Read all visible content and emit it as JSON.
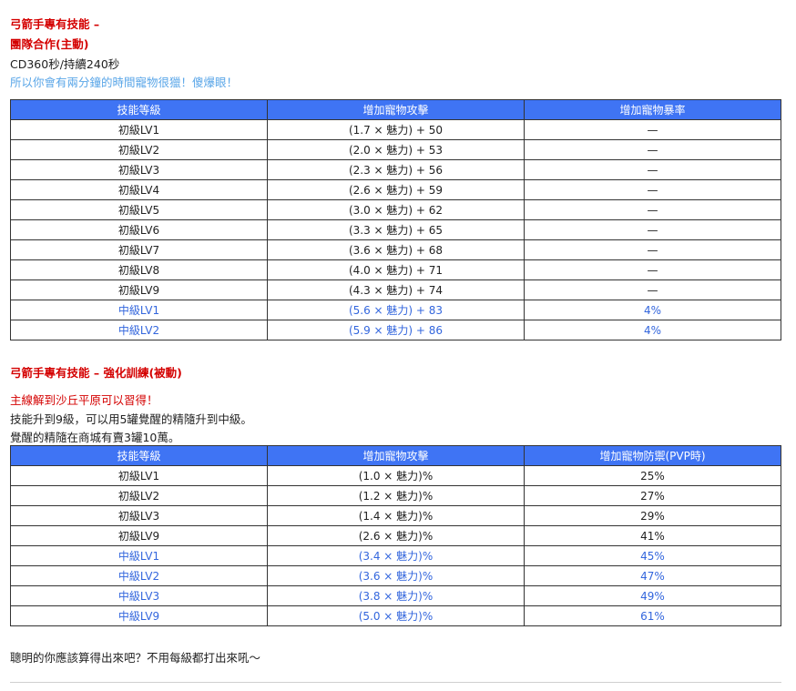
{
  "section1": {
    "heading": "弓箭手專有技能 –",
    "skill_name": "團隊合作(主動)",
    "cooldown": "CD360秒/持續240秒",
    "note": "所以你會有兩分鐘的時間寵物很獵！傻爆眼！",
    "table": {
      "headers": [
        "技能等級",
        "增加寵物攻擊",
        "增加寵物暴率"
      ],
      "rows": [
        {
          "level": "初級LV1",
          "attack": "(1.7 × 魅力) + 50",
          "extra": "—"
        },
        {
          "level": "初級LV2",
          "attack": "(2.0 × 魅力) + 53",
          "extra": "—"
        },
        {
          "level": "初級LV3",
          "attack": "(2.3 × 魅力) + 56",
          "extra": "—"
        },
        {
          "level": "初級LV4",
          "attack": "(2.6 × 魅力) + 59",
          "extra": "—"
        },
        {
          "level": "初級LV5",
          "attack": "(3.0 × 魅力) + 62",
          "extra": "—"
        },
        {
          "level": "初級LV6",
          "attack": "(3.3 × 魅力) + 65",
          "extra": "—"
        },
        {
          "level": "初級LV7",
          "attack": "(3.6 × 魅力) + 68",
          "extra": "—"
        },
        {
          "level": "初級LV8",
          "attack": "(4.0 × 魅力) + 71",
          "extra": "—"
        },
        {
          "level": "初級LV9",
          "attack": "(4.3 × 魅力) + 74",
          "extra": "—"
        },
        {
          "level": "中級LV1",
          "attack": "(5.6 × 魅力) + 83",
          "extra": "4%"
        },
        {
          "level": "中級LV2",
          "attack": "(5.9 × 魅力) + 86",
          "extra": "4%"
        }
      ]
    }
  },
  "section2": {
    "heading": "弓箭手專有技能 – 強化訓練(被動)",
    "quest_note": "主線解到沙丘平原可以習得！",
    "upgrade_note": "技能升到9級，可以用5罐覺醒的精隨升到中級。",
    "shop_note": "覺醒的精隨在商城有賣3罐10萬。",
    "table": {
      "headers": [
        "技能等級",
        "增加寵物攻擊",
        "增加寵物防禦(PVP時)"
      ],
      "rows": [
        {
          "level": "初級LV1",
          "attack": "(1.0 × 魅力)%",
          "extra": "25%"
        },
        {
          "level": "初級LV2",
          "attack": "(1.2 × 魅力)%",
          "extra": "27%"
        },
        {
          "level": "初級LV3",
          "attack": "(1.4 × 魅力)%",
          "extra": "29%"
        },
        {
          "level": "初級LV9",
          "attack": "(2.6 × 魅力)%",
          "extra": "41%"
        },
        {
          "level": "中級LV1",
          "attack": "(3.4 × 魅力)%",
          "extra": "45%"
        },
        {
          "level": "中級LV2",
          "attack": "(3.6 × 魅力)%",
          "extra": "47%"
        },
        {
          "level": "中級LV3",
          "attack": "(3.8 × 魅力)%",
          "extra": "49%"
        },
        {
          "level": "中級LV9",
          "attack": "(5.0 × 魅力)%",
          "extra": "61%"
        }
      ]
    }
  },
  "footer_note": "聰明的你應該算得出來吧？不用每級都打出來吼～"
}
